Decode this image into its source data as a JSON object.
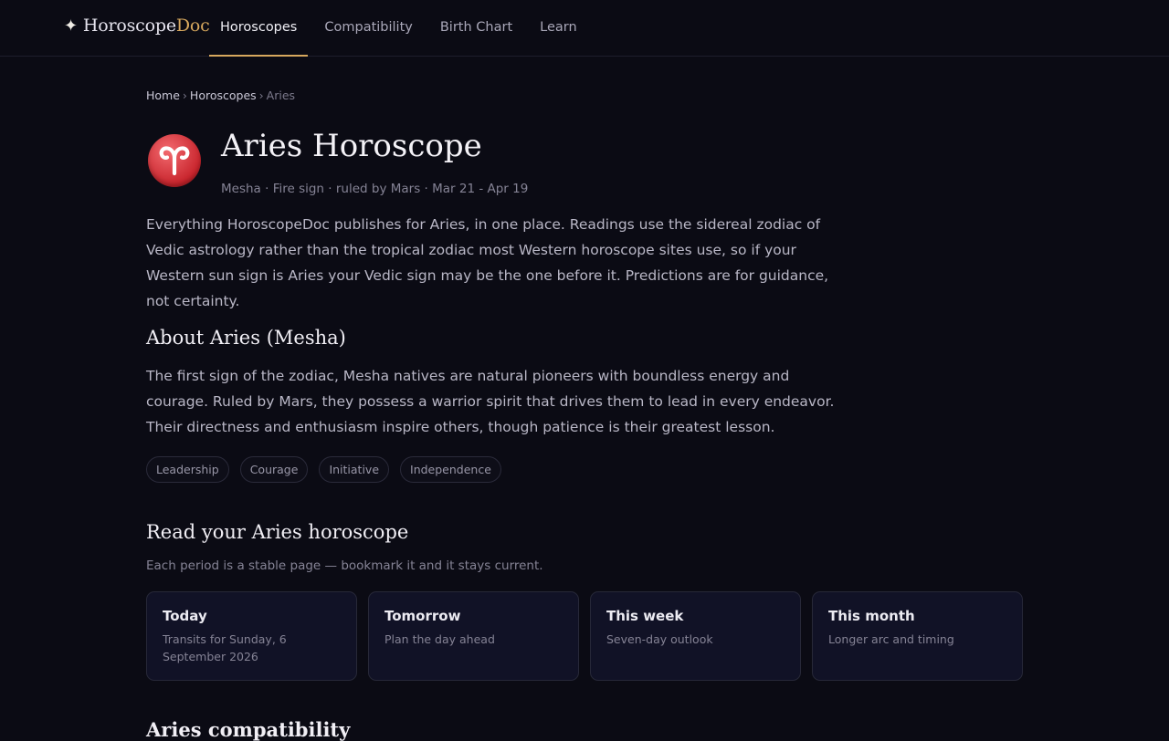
{
  "brand": {
    "star": "✦",
    "name_main": "Horoscope",
    "name_accent": "Doc"
  },
  "nav": {
    "items": [
      {
        "label": "Horoscopes",
        "active": true
      },
      {
        "label": "Compatibility",
        "active": false
      },
      {
        "label": "Birth Chart",
        "active": false
      },
      {
        "label": "Learn",
        "active": false
      }
    ]
  },
  "breadcrumb": {
    "home": "Home",
    "horoscopes": "Horoscopes",
    "current": "Aries",
    "sep": "›"
  },
  "header": {
    "icon": "aries-symbol-icon",
    "title": "Aries Horoscope",
    "subtitle": "Mesha · Fire sign · ruled by Mars · Mar 21 - Apr 19"
  },
  "intro": "Everything HoroscopeDoc publishes for Aries, in one place. Readings use the sidereal zodiac of Vedic astrology rather than the tropical zodiac most Western horoscope sites use, so if your Western sun sign is Aries your Vedic sign may be the one before it. Predictions are for guidance, not certainty.",
  "about": {
    "heading": "About Aries (Mesha)",
    "text": "The first sign of the zodiac, Mesha natives are natural pioneers with boundless energy and courage. Ruled by Mars, they possess a warrior spirit that drives them to lead in every endeavor. Their directness and enthusiasm inspire others, though patience is their greatest lesson.",
    "tags": [
      "Leadership",
      "Courage",
      "Initiative",
      "Independence"
    ]
  },
  "read": {
    "heading": "Read your Aries horoscope",
    "note": "Each period is a stable page — bookmark it and it stays current.",
    "cards": [
      {
        "title": "Today",
        "desc": "Transits for Sunday, 6 September 2026"
      },
      {
        "title": "Tomorrow",
        "desc": "Plan the day ahead"
      },
      {
        "title": "This week",
        "desc": "Seven-day outlook"
      },
      {
        "title": "This month",
        "desc": "Longer arc and timing"
      }
    ]
  },
  "compat": {
    "heading": "Aries compatibility"
  },
  "colors": {
    "background": "#0b0b14",
    "accent": "#d7a85e",
    "card": "#111226",
    "aries_red": "#c8242c"
  }
}
